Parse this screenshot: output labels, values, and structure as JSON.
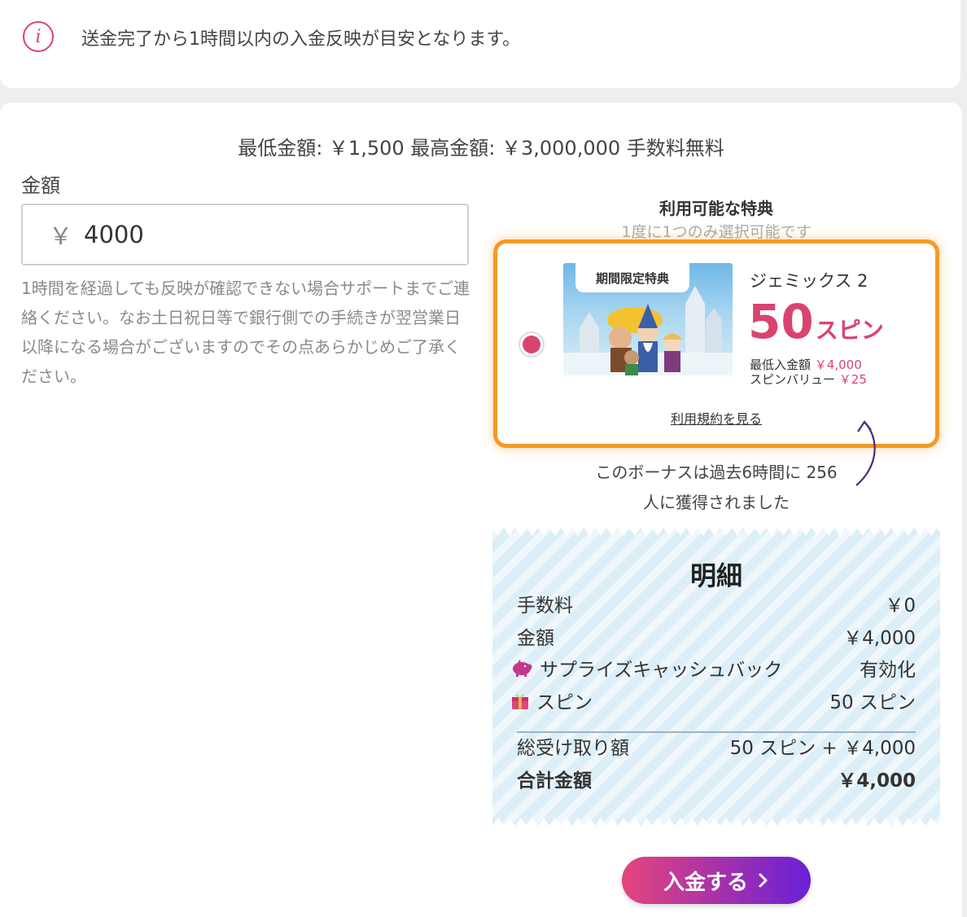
{
  "notice_bar": {
    "icon": "info-icon",
    "text": "送金完了から1時間以内の入金反映が目安となります。"
  },
  "limits_text": "最低金額: ￥1,500  最高金額: ￥3,000,000  手数料無料",
  "amount": {
    "label": "金額",
    "currency_symbol": "￥",
    "value": "4000"
  },
  "help_text": "1時間を経過しても反映が確認できない場合サポートまでご連絡ください。なお土日祝日等で銀行側での手続きが翌営業日以降になる場合がございますのでその点あらかじめご了承ください。",
  "bonus_section": {
    "title": "利用可能な特典",
    "subtitle": "1度に1つのみ選択可能です",
    "card": {
      "selected": true,
      "badge": "期間限定特典",
      "game_name": "ジェミックス 2",
      "spin_number": "50",
      "spin_unit": "スピン",
      "min_deposit_label": "最低入金額",
      "min_deposit_value": "￥4,000",
      "spin_value_label": "スピンバリュー",
      "spin_value_value": "￥25",
      "terms_link": "利用規約を見る"
    },
    "redeemed_line1": "このボーナスは過去6時間に 256",
    "redeemed_line2": "人に獲得されました"
  },
  "receipt": {
    "title": "明細",
    "rows": [
      {
        "label": "手数料",
        "value": "￥0"
      },
      {
        "label": "金額",
        "value": "￥4,000"
      },
      {
        "label": "サプライズキャッシュバック",
        "value": "有効化",
        "icon": "piggy-bank-icon"
      },
      {
        "label": "スピン",
        "value": "50 スピン",
        "icon": "gift-icon"
      }
    ],
    "total_received_label": "総受け取り額",
    "total_received_value": "50 スピン + ￥4,000",
    "total_amount_label": "合計金額",
    "total_amount_value": "￥4,000"
  },
  "deposit_button_label": "入金する",
  "colors": {
    "accent_pink": "#d9446f",
    "highlight_orange": "#f49a23",
    "button_gradient_start": "#e5457d",
    "button_gradient_end": "#6a1fd6",
    "receipt_background": "#dceef7"
  }
}
